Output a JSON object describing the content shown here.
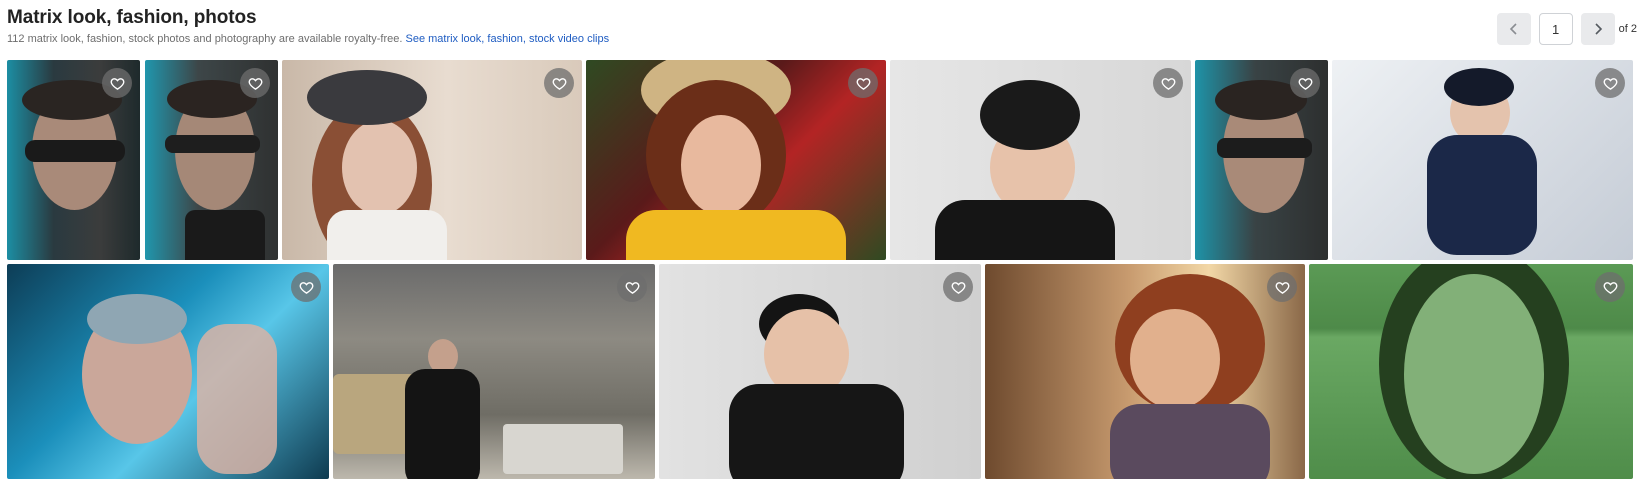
{
  "header": {
    "title": "Matrix look, fashion, photos",
    "subtitle": "112 matrix look, fashion, stock photos and photography are available royalty-free.",
    "video_link": "See matrix look, fashion, stock video clips"
  },
  "pager": {
    "current_page": "1",
    "total_label": "of 2"
  },
  "icons": {
    "prev": "chevron-left-icon",
    "next": "chevron-right-icon",
    "favorite": "heart-outline-icon"
  },
  "colors": {
    "link": "#1e5cc2",
    "favorite_button": "#6e6e6e"
  }
}
